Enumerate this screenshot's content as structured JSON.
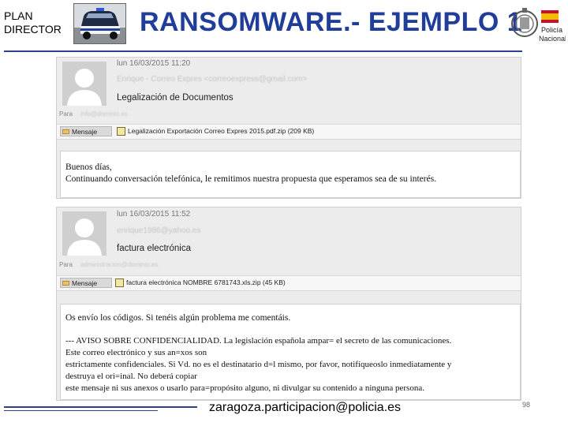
{
  "header": {
    "plan_line1": "PLAN",
    "plan_line2": "DIRECTOR",
    "title": "RANSOMWARE.- EJEMPLO 1",
    "seal_text_1": "Policía",
    "seal_text_2": "Nacional",
    "brand_blue": "#1f3d99"
  },
  "emails": [
    {
      "date": "lun 16/03/2015 11:20",
      "sender": "Enrique - Correo Expres <correoexpress@gmail.com>",
      "subject": "Legalización de Documentos",
      "to_label": "Para",
      "to_value": "info@dominio.es",
      "message_button": "Mensaje",
      "attachment": "Legalización Exportación Correo Expres 2015.pdf.zip (209 KB)",
      "body_lines": [
        "Buenos días,",
        "Continuando conversación telefónica, le remitimos nuestra propuesta que esperamos sea de su interés."
      ]
    },
    {
      "date": "lun 16/03/2015 11:52",
      "sender": "enrique1986@yahoo.es",
      "subject": "factura electrónica",
      "to_label": "Para",
      "to_value": "administracion@dominio.es",
      "message_button": "Mensaje",
      "attachment": "factura electrónica NOMBRE 6781743.xls.zip (45 KB)",
      "body_lines": [
        "Os envío los códigos. Si tenéis algún problema me comentáis.",
        "--- AVISO SOBRE CONFIDENCIALIDAD. La legislación española ampar= el secreto de las comunicaciones.",
        "Este correo electrónico y sus an=xos son",
        "estrictamente confidenciales. Si Vd. no es el destinatario d=l mismo, por favor, notifíqueoslo inmediatamente y",
        "destruya el ori=inal. No deberá copiar",
        "este mensaje ni sus anexos o usarlo para=propósito alguno, ni divulgar su contenido a ninguna persona."
      ]
    }
  ],
  "footer": {
    "email": "zaragoza.participacion@policia.es",
    "page_number": "98"
  }
}
